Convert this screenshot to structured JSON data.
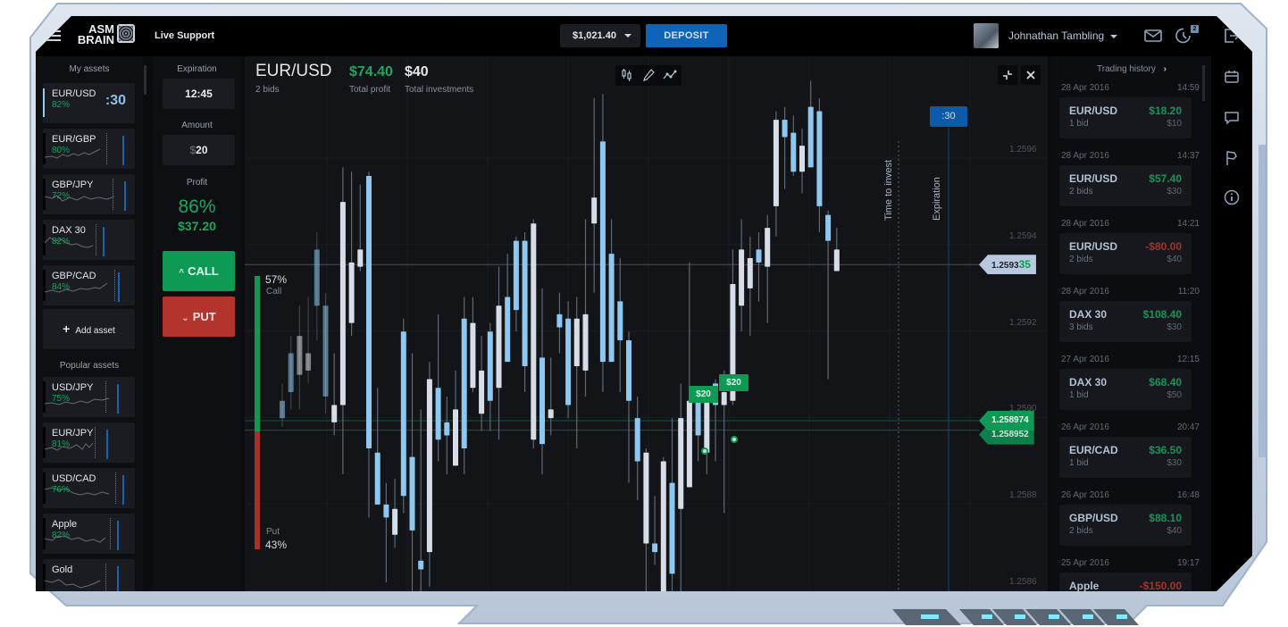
{
  "app": {
    "brand_line1": "ASM",
    "brand_line2": "BRAIN",
    "live_support": "Live Support"
  },
  "header": {
    "balance": "$1,021.40",
    "deposit_label": "DEPOSIT",
    "username": "Johnathan Tambling",
    "notification_count": "2",
    "icons": [
      "menu-icon",
      "mail-icon",
      "history-clock-icon",
      "logout-icon"
    ]
  },
  "my_assets": {
    "heading": "My assets",
    "items": [
      {
        "name": "EUR/USD",
        "pct": "82%",
        "timer": ":30",
        "active": true
      },
      {
        "name": "EUR/GBP",
        "pct": "80%"
      },
      {
        "name": "GBP/JPY",
        "pct": "72%"
      },
      {
        "name": "DAX 30",
        "pct": "82%"
      },
      {
        "name": "GBP/CAD",
        "pct": "84%"
      }
    ],
    "add_label": "Add asset"
  },
  "popular_assets": {
    "heading": "Popular assets",
    "items": [
      {
        "name": "USD/JPY",
        "pct": "75%"
      },
      {
        "name": "EUR/JPY",
        "pct": "81%"
      },
      {
        "name": "USD/CAD",
        "pct": "76%"
      },
      {
        "name": "Apple",
        "pct": "82%"
      },
      {
        "name": "Gold",
        "pct": ""
      }
    ]
  },
  "trade_panel": {
    "expiration_label": "Expiration",
    "expiration_value": "12:45",
    "amount_label": "Amount",
    "amount_currency": "$",
    "amount_value": "20",
    "profit_label": "Profit",
    "profit_pct": "86%",
    "profit_amount": "$37.20",
    "call_label": "CALL",
    "put_label": "PUT"
  },
  "chart_header": {
    "pair": "EUR/USD",
    "bids": "2 bids",
    "total_profit_value": "$74.40",
    "total_profit_label": "Total profit",
    "total_investments_value": "$40",
    "total_investments_label": "Total investments",
    "tools": [
      "candlestick-icon",
      "pencil-icon",
      "line-chart-icon"
    ],
    "controls": [
      "collapse-icon",
      "close-icon"
    ]
  },
  "chart_overlay": {
    "expiration_timer": ":30",
    "time_to_invest_label": "Time to invest",
    "expiration_label": "Expiration",
    "current_price_main": "1.2593",
    "current_price_tail": "35",
    "trade_prices": [
      "1.258974",
      "1.258952"
    ],
    "trade_tags": [
      "$20",
      "$20"
    ],
    "sentiment": {
      "call_pct": 57,
      "call_label": "Call",
      "call_text": "57%",
      "put_pct": 43,
      "put_label": "Put",
      "put_text": "43%"
    }
  },
  "chart_data": {
    "type": "candlestick",
    "title": "EUR/USD",
    "ylabel": "",
    "yticks": [
      "1.2596",
      "1.2594",
      "1.2592",
      "1.2590",
      "1.2588",
      "1.2586"
    ],
    "ylim": [
      1.25853,
      1.25972
    ],
    "grid": true,
    "current_price": 1.259335,
    "trade_levels": [
      1.258974,
      1.258952
    ],
    "candles": [
      {
        "o": 1.25898,
        "c": 1.25902,
        "h": 1.25906,
        "l": 1.25896,
        "dir": "down"
      },
      {
        "o": 1.25904,
        "c": 1.25913,
        "h": 1.25917,
        "l": 1.259,
        "dir": "down"
      },
      {
        "o": 1.25917,
        "c": 1.25908,
        "h": 1.25924,
        "l": 1.259,
        "dir": "up"
      },
      {
        "o": 1.25909,
        "c": 1.25913,
        "h": 1.25926,
        "l": 1.25906,
        "dir": "up"
      },
      {
        "o": 1.25924,
        "c": 1.25937,
        "h": 1.25941,
        "l": 1.25916,
        "dir": "down"
      },
      {
        "o": 1.25903,
        "c": 1.25924,
        "h": 1.25927,
        "l": 1.25899,
        "dir": "down"
      },
      {
        "o": 1.25897,
        "c": 1.25901,
        "h": 1.25913,
        "l": 1.25894,
        "dir": "up"
      },
      {
        "o": 1.25901,
        "c": 1.25948,
        "h": 1.25956,
        "l": 1.25885,
        "dir": "up"
      },
      {
        "o": 1.2592,
        "c": 1.25934,
        "h": 1.25955,
        "l": 1.25917,
        "dir": "up"
      },
      {
        "o": 1.25933,
        "c": 1.25937,
        "h": 1.25952,
        "l": 1.25932,
        "dir": "up"
      },
      {
        "o": 1.25954,
        "c": 1.25891,
        "h": 1.25955,
        "l": 1.25875,
        "dir": "down"
      },
      {
        "o": 1.2589,
        "c": 1.25878,
        "h": 1.25905,
        "l": 1.25879,
        "dir": "down"
      },
      {
        "o": 1.25878,
        "c": 1.25875,
        "h": 1.25883,
        "l": 1.2586,
        "dir": "down"
      },
      {
        "o": 1.25871,
        "c": 1.25877,
        "h": 1.25884,
        "l": 1.25868,
        "dir": "up"
      },
      {
        "o": 1.25918,
        "c": 1.2588,
        "h": 1.25921,
        "l": 1.25876,
        "dir": "down"
      },
      {
        "o": 1.25872,
        "c": 1.25889,
        "h": 1.25913,
        "l": 1.25858,
        "dir": "down"
      },
      {
        "o": 1.25863,
        "c": 1.25865,
        "h": 1.259,
        "l": 1.2585,
        "dir": "down"
      },
      {
        "o": 1.25867,
        "c": 1.25907,
        "h": 1.25911,
        "l": 1.25859,
        "dir": "up"
      },
      {
        "o": 1.25893,
        "c": 1.25905,
        "h": 1.25922,
        "l": 1.25888,
        "dir": "down"
      },
      {
        "o": 1.25894,
        "c": 1.25897,
        "h": 1.25903,
        "l": 1.25885,
        "dir": "down"
      },
      {
        "o": 1.25887,
        "c": 1.259,
        "h": 1.25909,
        "l": 1.25887,
        "dir": "up"
      },
      {
        "o": 1.25921,
        "c": 1.25891,
        "h": 1.25926,
        "l": 1.25885,
        "dir": "down"
      },
      {
        "o": 1.25905,
        "c": 1.2592,
        "h": 1.25926,
        "l": 1.25904,
        "dir": "up"
      },
      {
        "o": 1.25899,
        "c": 1.25909,
        "h": 1.25917,
        "l": 1.25895,
        "dir": "up"
      },
      {
        "o": 1.25918,
        "c": 1.25902,
        "h": 1.2592,
        "l": 1.25895,
        "dir": "down"
      },
      {
        "o": 1.25905,
        "c": 1.25924,
        "h": 1.25933,
        "l": 1.25893,
        "dir": "up"
      },
      {
        "o": 1.25926,
        "c": 1.25911,
        "h": 1.25936,
        "l": 1.25912,
        "dir": "down"
      },
      {
        "o": 1.25939,
        "c": 1.25923,
        "h": 1.2594,
        "l": 1.25918,
        "dir": "down"
      },
      {
        "o": 1.25939,
        "c": 1.2591,
        "h": 1.25941,
        "l": 1.25904,
        "dir": "down"
      },
      {
        "o": 1.25893,
        "c": 1.25943,
        "h": 1.25944,
        "l": 1.25891,
        "dir": "up"
      },
      {
        "o": 1.25892,
        "c": 1.25912,
        "h": 1.25928,
        "l": 1.25885,
        "dir": "down"
      },
      {
        "o": 1.25898,
        "c": 1.259,
        "h": 1.25912,
        "l": 1.25894,
        "dir": "up"
      },
      {
        "o": 1.25919,
        "c": 1.25922,
        "h": 1.25927,
        "l": 1.25913,
        "dir": "down"
      },
      {
        "o": 1.25921,
        "c": 1.25901,
        "h": 1.25925,
        "l": 1.25898,
        "dir": "down"
      },
      {
        "o": 1.25921,
        "c": 1.2591,
        "h": 1.25926,
        "l": 1.25891,
        "dir": "up"
      },
      {
        "o": 1.25909,
        "c": 1.25922,
        "h": 1.25944,
        "l": 1.25903,
        "dir": "up"
      },
      {
        "o": 1.25943,
        "c": 1.25949,
        "h": 1.25972,
        "l": 1.25927,
        "dir": "up"
      },
      {
        "o": 1.25962,
        "c": 1.25911,
        "h": 1.25973,
        "l": 1.25904,
        "dir": "down"
      },
      {
        "o": 1.25911,
        "c": 1.25936,
        "h": 1.25944,
        "l": 1.25912,
        "dir": "down"
      },
      {
        "o": 1.25925,
        "c": 1.25916,
        "h": 1.25935,
        "l": 1.25904,
        "dir": "down"
      },
      {
        "o": 1.25902,
        "c": 1.25916,
        "h": 1.25918,
        "l": 1.25883,
        "dir": "down"
      },
      {
        "o": 1.25888,
        "c": 1.25898,
        "h": 1.25903,
        "l": 1.25879,
        "dir": "down"
      },
      {
        "o": 1.25869,
        "c": 1.2589,
        "h": 1.25891,
        "l": 1.25855,
        "dir": "up"
      },
      {
        "o": 1.25867,
        "c": 1.25869,
        "h": 1.2588,
        "l": 1.25864,
        "dir": "down"
      },
      {
        "o": 1.2585,
        "c": 1.25888,
        "h": 1.25889,
        "l": 1.25842,
        "dir": "up"
      },
      {
        "o": 1.25883,
        "c": 1.25862,
        "h": 1.25898,
        "l": 1.25858,
        "dir": "down"
      },
      {
        "o": 1.25877,
        "c": 1.25898,
        "h": 1.25906,
        "l": 1.25845,
        "dir": "up"
      },
      {
        "o": 1.25882,
        "c": 1.25902,
        "h": 1.25934,
        "l": 1.25883,
        "dir": "up"
      },
      {
        "o": 1.25904,
        "c": 1.25894,
        "h": 1.25905,
        "l": 1.25888,
        "dir": "down"
      },
      {
        "o": 1.2589,
        "c": 1.25903,
        "h": 1.25905,
        "l": 1.25885,
        "dir": "up"
      },
      {
        "o": 1.25901,
        "c": 1.25906,
        "h": 1.25907,
        "l": 1.25888,
        "dir": "down"
      },
      {
        "o": 1.25904,
        "c": 1.25901,
        "h": 1.25909,
        "l": 1.25876,
        "dir": "up"
      },
      {
        "o": 1.25902,
        "c": 1.25929,
        "h": 1.25937,
        "l": 1.25901,
        "dir": "up"
      },
      {
        "o": 1.25924,
        "c": 1.25937,
        "h": 1.25944,
        "l": 1.25918,
        "dir": "up"
      },
      {
        "o": 1.25928,
        "c": 1.25935,
        "h": 1.2594,
        "l": 1.25917,
        "dir": "up"
      },
      {
        "o": 1.25937,
        "c": 1.25934,
        "h": 1.25941,
        "l": 1.25925,
        "dir": "down"
      },
      {
        "o": 1.25933,
        "c": 1.25942,
        "h": 1.25945,
        "l": 1.2592,
        "dir": "up"
      },
      {
        "o": 1.25947,
        "c": 1.25967,
        "h": 1.25969,
        "l": 1.2594,
        "dir": "up"
      },
      {
        "o": 1.25967,
        "c": 1.25963,
        "h": 1.2597,
        "l": 1.25951,
        "dir": "down"
      },
      {
        "o": 1.25964,
        "c": 1.25955,
        "h": 1.25968,
        "l": 1.25954,
        "dir": "down"
      },
      {
        "o": 1.25955,
        "c": 1.25961,
        "h": 1.25965,
        "l": 1.2595,
        "dir": "up"
      },
      {
        "o": 1.2597,
        "c": 1.25956,
        "h": 1.25976,
        "l": 1.25956,
        "dir": "down"
      },
      {
        "o": 1.25969,
        "c": 1.25947,
        "h": 1.25972,
        "l": 1.25941,
        "dir": "down"
      },
      {
        "o": 1.25945,
        "c": 1.25939,
        "h": 1.25946,
        "l": 1.25907,
        "dir": "down"
      },
      {
        "o": 1.25937,
        "c": 1.25932,
        "h": 1.25942,
        "l": 1.25932,
        "dir": "up"
      }
    ]
  },
  "trading_history": {
    "heading": "Trading history",
    "entries": [
      {
        "date": "28 Apr 2016",
        "time": "14:59",
        "asset": "EUR/USD",
        "bids": "1 bid",
        "profit": "$18.20",
        "positive": true,
        "invested": "$10"
      },
      {
        "date": "28 Apr 2016",
        "time": "14:37",
        "asset": "EUR/USD",
        "bids": "2 bids",
        "profit": "$57.40",
        "positive": true,
        "invested": "$30"
      },
      {
        "date": "28 Apr 2016",
        "time": "14:21",
        "asset": "EUR/USD",
        "bids": "2 bids",
        "profit": "-$80.00",
        "positive": false,
        "invested": "$40"
      },
      {
        "date": "28 Apr 2016",
        "time": "11:20",
        "asset": "DAX 30",
        "bids": "3 bids",
        "profit": "$108.40",
        "positive": true,
        "invested": "$30"
      },
      {
        "date": "27 Apr 2016",
        "time": "12:15",
        "asset": "DAX 30",
        "bids": "1 bid",
        "profit": "$68.40",
        "positive": true,
        "invested": "$50"
      },
      {
        "date": "26 Apr 2016",
        "time": "20:47",
        "asset": "EUR/CAD",
        "bids": "1 bid",
        "profit": "$36.50",
        "positive": true,
        "invested": "$30"
      },
      {
        "date": "26 Apr 2016",
        "time": "16:48",
        "asset": "GBP/USD",
        "bids": "2 bids",
        "profit": "$88.10",
        "positive": true,
        "invested": "$40"
      },
      {
        "date": "25 Apr 2016",
        "time": "19:17",
        "asset": "Apple",
        "bids": "",
        "profit": "-$150.00",
        "positive": false,
        "invested": ""
      }
    ]
  },
  "side_icons": [
    "calendar-icon",
    "chat-icon",
    "flag-icon",
    "info-icon"
  ],
  "colors": {
    "positive": "#18a862",
    "negative": "#b3342c",
    "accent_blue": "#0d64b8",
    "candle_up": "#d6dde6",
    "candle_down": "#8ec8f0"
  }
}
